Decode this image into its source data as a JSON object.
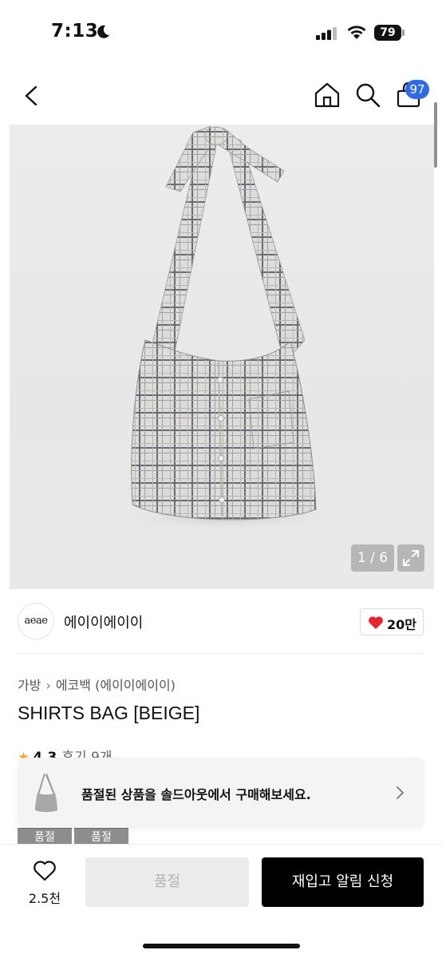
{
  "status_bar": {
    "time": "7:13",
    "battery": "79"
  },
  "nav": {
    "cart_badge": "97",
    "icons": [
      "back-icon",
      "home-icon",
      "search-icon",
      "cart-icon"
    ]
  },
  "gallery": {
    "counter": "1 / 6"
  },
  "brand": {
    "logo_text": "aeae",
    "name": "에이이에이이",
    "likes": "20만"
  },
  "breadcrumb": {
    "category": "가방",
    "subcategory": "에코백 (에이이에이이)"
  },
  "product": {
    "title": "SHIRTS BAG [BEIGE]",
    "rating": "4.3",
    "reviews": "후기 9개"
  },
  "soldout_banner": {
    "text": "품절된 상품을 솔드아웃에서 구매해보세요."
  },
  "options": [
    {
      "label": "품절"
    },
    {
      "label": "품절"
    }
  ],
  "bottom_bar": {
    "wish_count": "2.5천",
    "soldout_label": "품절",
    "restock_label": "재입고 알림 신청"
  },
  "colors": {
    "badge_blue": "#2f6be6",
    "heart_red": "#e8222f",
    "star_orange": "#f0a92b",
    "primary_black": "#000000"
  }
}
